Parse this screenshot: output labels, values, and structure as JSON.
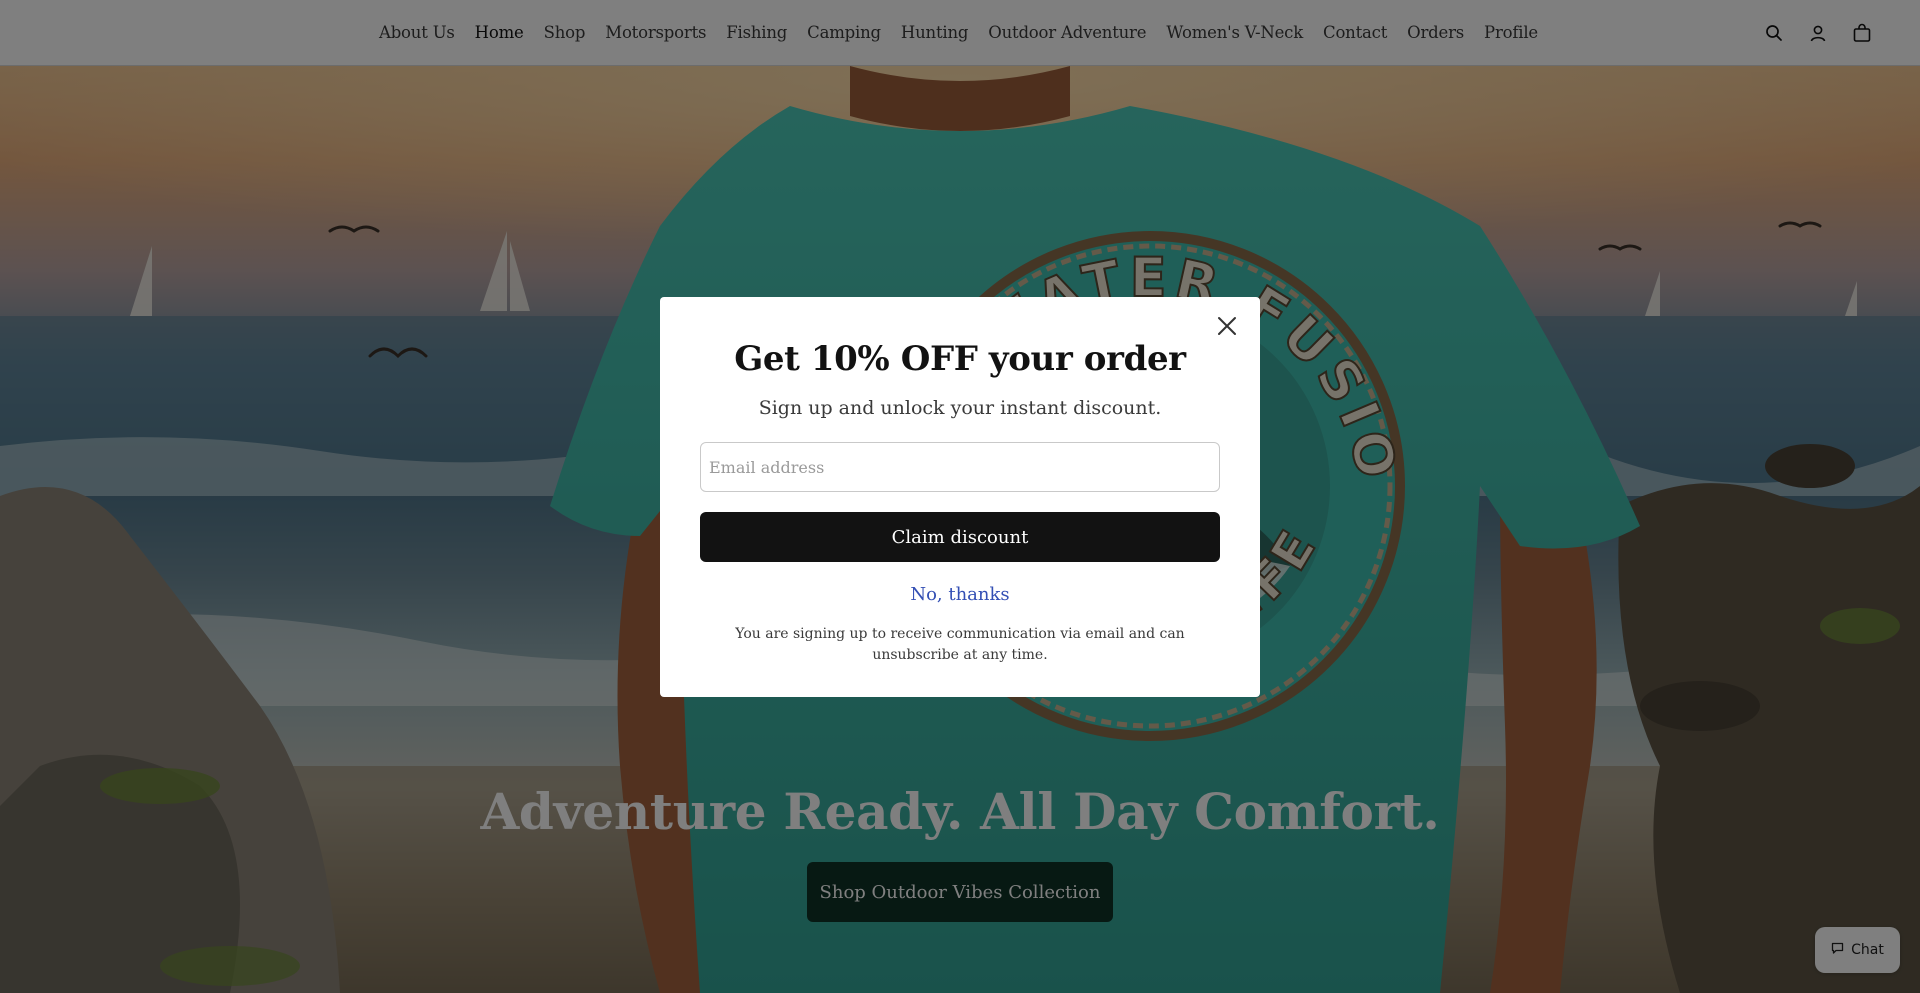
{
  "header": {
    "nav_items": [
      {
        "label": "About Us"
      },
      {
        "label": "Home"
      },
      {
        "label": "Shop"
      },
      {
        "label": "Motorsports"
      },
      {
        "label": "Fishing"
      },
      {
        "label": "Camping"
      },
      {
        "label": "Hunting"
      },
      {
        "label": "Outdoor Adventure"
      },
      {
        "label": "Women's V-Neck"
      },
      {
        "label": "Contact"
      },
      {
        "label": "Orders"
      },
      {
        "label": "Profile"
      }
    ],
    "active_nav": "Home",
    "icons": [
      "search-icon",
      "account-icon",
      "cart-icon"
    ]
  },
  "hero": {
    "heading": "Adventure Ready. All Day Comfort.",
    "button_label": "Shop Outdoor Vibes Collection",
    "shirt_logo_text_top": "SALT WATER FUSION",
    "shirt_logo_text_bottom": "LIFE"
  },
  "modal": {
    "title": "Get 10% OFF your order",
    "subtitle": "Sign up and unlock your instant discount.",
    "email_placeholder": "Email address",
    "email_value": "",
    "claim_label": "Claim discount",
    "decline_label": "No, thanks",
    "disclaimer": "You are signing up to receive communication via email and can unsubscribe at any time."
  },
  "chat": {
    "label": "Chat"
  },
  "colors": {
    "overlay": "rgba(0,0,0,0.5)",
    "claim_button": "#121212",
    "decline_link": "#334fb4",
    "hero_button": "#0e3326",
    "shirt": "#3fbfb0"
  }
}
